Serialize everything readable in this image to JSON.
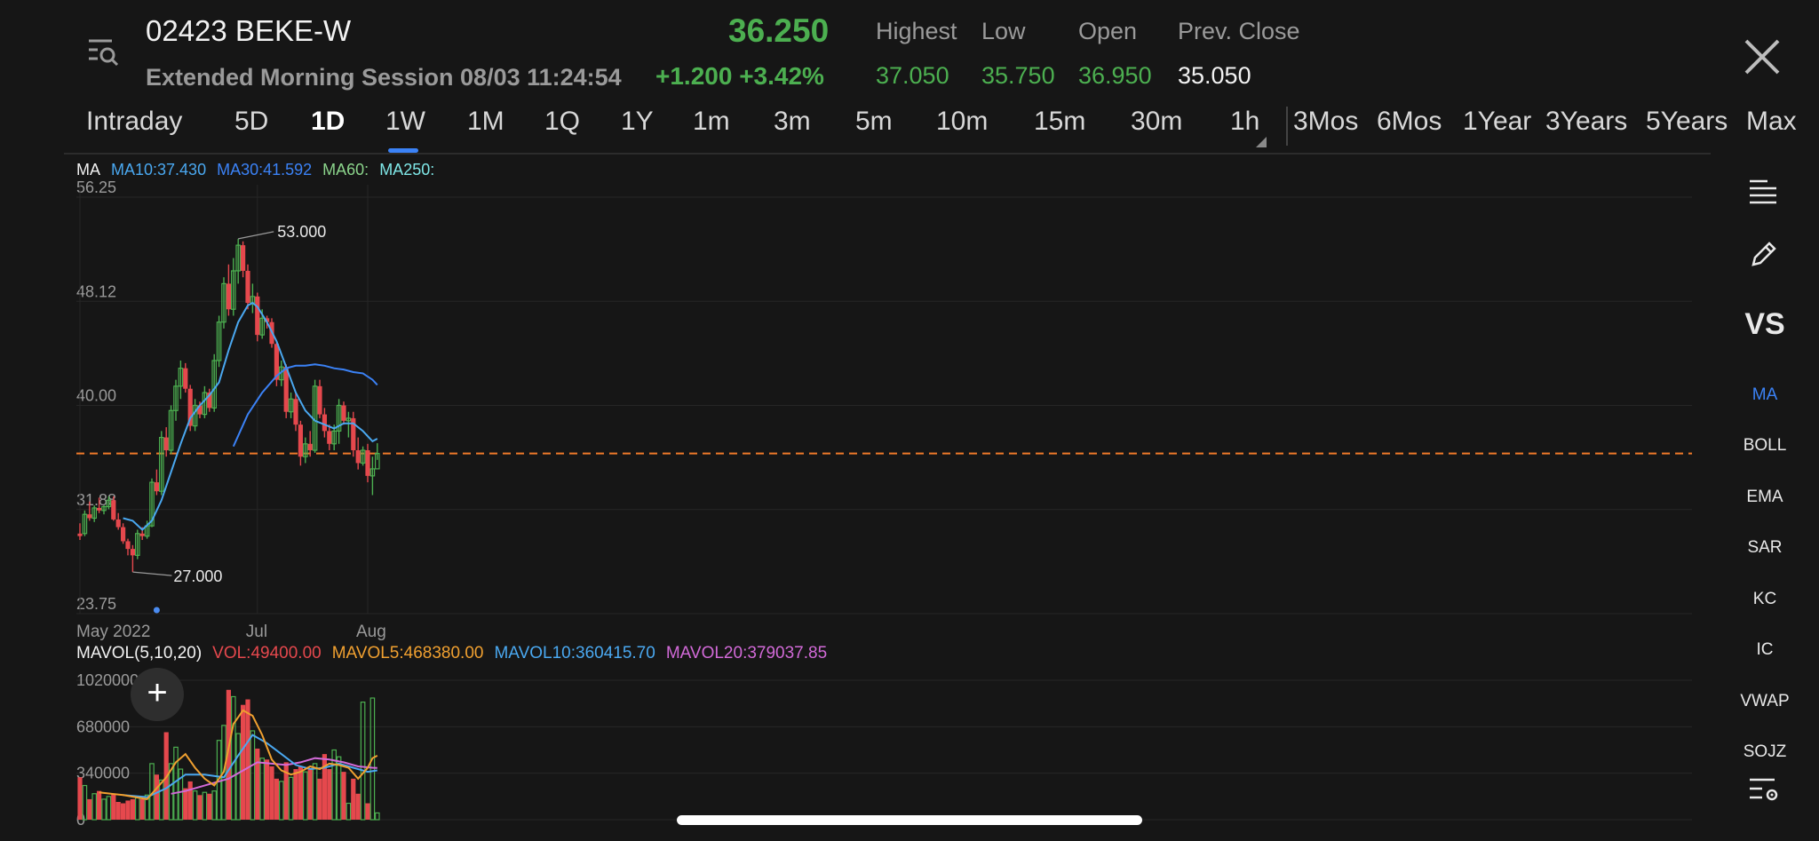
{
  "header": {
    "ticker": "02423 BEKE-W",
    "session": "Extended Morning Session 08/03 11:24:54",
    "price": "36.250",
    "change": "+1.200",
    "change_pct": "+3.42%",
    "stats": [
      {
        "label": "Highest",
        "value": "37.050"
      },
      {
        "label": "Low",
        "value": "35.750"
      },
      {
        "label": "Open",
        "value": "36.950"
      },
      {
        "label": "Prev. Close",
        "value": "35.050"
      }
    ],
    "menu_icon": "list-search-icon",
    "close_icon": "close-icon"
  },
  "tabs": [
    "Intraday",
    "5D",
    "1D",
    "1W",
    "1M",
    "1Q",
    "1Y",
    "1m",
    "3m",
    "5m",
    "10m",
    "15m",
    "30m",
    "1h",
    "3Mos",
    "6Mos",
    "1Year",
    "3Years",
    "5Years",
    "Max"
  ],
  "active_tab": "1D",
  "ma_legend": {
    "title": "MA",
    "ma10": "MA10:37.430",
    "ma30": "MA30:41.592",
    "ma60": "MA60:",
    "ma250": "MA250:"
  },
  "mavol_legend": {
    "title": "MAVOL(5,10,20)",
    "vol": "VOL:49400.00",
    "mavol5": "MAVOL5:468380.00",
    "mavol10": "MAVOL10:360415.70",
    "mavol20": "MAVOL20:379037.85"
  },
  "right_panel": {
    "icons": [
      "indicator-list-icon",
      "pencil-icon",
      "indicator-settings-icon"
    ],
    "vs": "VS",
    "indicators": [
      "MA",
      "BOLL",
      "EMA",
      "SAR",
      "KC",
      "IC",
      "VWAP",
      "SOJZ"
    ],
    "active_indicator": "MA"
  },
  "plus_label": "+",
  "colors": {
    "up": "#4caf50",
    "down": "#e5484d",
    "ma10": "#4aa8f0",
    "ma30": "#3b82f6",
    "accent": "#3b82f6",
    "ref_line": "#f07a2a"
  },
  "chart_data": [
    {
      "type": "candlestick",
      "title": "",
      "y_ticks": [
        "56.25",
        "48.12",
        "40.00",
        "31.88",
        "23.75"
      ],
      "ylim": [
        23.75,
        56.25
      ],
      "x_ticks": [
        "May 2022",
        "Jul",
        "Aug"
      ],
      "annotations": {
        "high": "53.000",
        "low": "27.000"
      },
      "reference_price": 36.25,
      "ohlc": [
        [
          30.0,
          30.8,
          29.5,
          29.8
        ],
        [
          30.0,
          31.8,
          29.8,
          31.5
        ],
        [
          31.5,
          32.5,
          31.0,
          31.2
        ],
        [
          31.2,
          32.2,
          30.9,
          32.0
        ],
        [
          32.0,
          32.8,
          31.6,
          31.8
        ],
        [
          31.8,
          32.2,
          31.5,
          32.1
        ],
        [
          32.1,
          32.9,
          31.9,
          32.6
        ],
        [
          32.6,
          32.9,
          31.0,
          31.1
        ],
        [
          31.1,
          31.6,
          30.3,
          30.5
        ],
        [
          30.5,
          30.8,
          29.2,
          29.4
        ],
        [
          29.4,
          29.6,
          28.3,
          28.8
        ],
        [
          28.8,
          29.1,
          27.0,
          28.3
        ],
        [
          28.3,
          30.3,
          28.0,
          30.0
        ],
        [
          30.0,
          30.5,
          29.5,
          29.8
        ],
        [
          29.8,
          31.0,
          29.6,
          30.6
        ],
        [
          30.6,
          34.3,
          30.5,
          34.0
        ],
        [
          34.0,
          35.0,
          33.0,
          33.3
        ],
        [
          33.3,
          38.0,
          33.0,
          37.5
        ],
        [
          37.5,
          38.3,
          36.0,
          36.5
        ],
        [
          36.5,
          40.0,
          36.2,
          39.6
        ],
        [
          39.6,
          42.0,
          38.8,
          41.5
        ],
        [
          41.5,
          43.5,
          40.5,
          42.9
        ],
        [
          42.9,
          43.3,
          41.0,
          41.3
        ],
        [
          41.3,
          41.6,
          38.0,
          38.4
        ],
        [
          38.4,
          40.5,
          38.0,
          40.0
        ],
        [
          40.0,
          40.3,
          39.0,
          39.3
        ],
        [
          39.3,
          41.5,
          39.0,
          41.0
        ],
        [
          41.0,
          41.3,
          39.5,
          39.8
        ],
        [
          39.8,
          44.0,
          39.5,
          43.5
        ],
        [
          43.5,
          47.0,
          43.0,
          46.5
        ],
        [
          46.5,
          50.0,
          46.0,
          49.5
        ],
        [
          49.5,
          51.0,
          47.0,
          47.5
        ],
        [
          47.5,
          51.5,
          47.0,
          50.5
        ],
        [
          50.5,
          53.0,
          49.5,
          52.5
        ],
        [
          52.5,
          52.8,
          50.0,
          50.5
        ],
        [
          50.5,
          51.0,
          47.5,
          48.0
        ],
        [
          48.0,
          49.5,
          47.2,
          48.5
        ],
        [
          48.5,
          48.8,
          45.0,
          45.5
        ],
        [
          45.5,
          47.5,
          45.2,
          46.8
        ],
        [
          46.8,
          47.0,
          46.0,
          46.5
        ],
        [
          46.5,
          46.8,
          44.5,
          44.8
        ],
        [
          44.8,
          45.0,
          41.5,
          42.0
        ],
        [
          42.0,
          43.5,
          41.5,
          43.0
        ],
        [
          43.0,
          43.2,
          39.0,
          39.5
        ],
        [
          39.5,
          41.0,
          39.0,
          40.5
        ],
        [
          40.5,
          41.0,
          38.0,
          38.5
        ],
        [
          38.5,
          38.8,
          35.3,
          36.0
        ],
        [
          36.0,
          37.5,
          35.5,
          37.0
        ],
        [
          37.0,
          38.0,
          36.0,
          36.5
        ],
        [
          36.5,
          42.0,
          36.3,
          41.5
        ],
        [
          41.5,
          42.0,
          39.0,
          39.3
        ],
        [
          39.3,
          39.8,
          37.5,
          38.0
        ],
        [
          38.0,
          38.5,
          36.5,
          37.0
        ],
        [
          37.0,
          38.5,
          36.5,
          38.0
        ],
        [
          38.0,
          40.5,
          37.0,
          40.0
        ],
        [
          40.0,
          40.3,
          38.5,
          38.8
        ],
        [
          38.8,
          39.5,
          37.5,
          39.0
        ],
        [
          39.0,
          39.5,
          36.0,
          36.5
        ],
        [
          36.5,
          37.5,
          35.0,
          35.5
        ],
        [
          35.5,
          36.8,
          35.3,
          36.5
        ],
        [
          36.5,
          37.0,
          34.0,
          34.5
        ],
        [
          34.5,
          36.0,
          33.0,
          35.05
        ],
        [
          35.05,
          37.05,
          35.75,
          36.25
        ]
      ],
      "ma10": [
        [
          9,
          31.2
        ],
        [
          11,
          31.0
        ],
        [
          13,
          30.3
        ],
        [
          15,
          31.0
        ],
        [
          17,
          32.6
        ],
        [
          19,
          34.8
        ],
        [
          21,
          37.0
        ],
        [
          23,
          39.0
        ],
        [
          25,
          40.0
        ],
        [
          27,
          40.8
        ],
        [
          29,
          41.8
        ],
        [
          31,
          44.3
        ],
        [
          33,
          46.5
        ],
        [
          35,
          47.8
        ],
        [
          36,
          48.0
        ],
        [
          37,
          47.7
        ],
        [
          39,
          46.5
        ],
        [
          41,
          45.0
        ],
        [
          43,
          43.0
        ],
        [
          45,
          41.0
        ],
        [
          47,
          39.6
        ],
        [
          49,
          38.8
        ],
        [
          51,
          38.5
        ],
        [
          53,
          38.2
        ],
        [
          55,
          38.6
        ],
        [
          57,
          38.6
        ],
        [
          59,
          38.0
        ],
        [
          61,
          37.2
        ],
        [
          62,
          37.4
        ]
      ],
      "ma30": [
        [
          32,
          36.8
        ],
        [
          35,
          39.3
        ],
        [
          38,
          41.0
        ],
        [
          41,
          42.3
        ],
        [
          43,
          42.9
        ],
        [
          45,
          43.1
        ],
        [
          47,
          43.1
        ],
        [
          49,
          43.2
        ],
        [
          51,
          43.1
        ],
        [
          53,
          42.9
        ],
        [
          55,
          42.8
        ],
        [
          57,
          42.6
        ],
        [
          59,
          42.5
        ],
        [
          61,
          42.0
        ],
        [
          62,
          41.6
        ]
      ]
    },
    {
      "type": "bar",
      "title": "",
      "y_ticks": [
        "1020000",
        "680000",
        "340000",
        "0"
      ],
      "ylim": [
        0,
        1020000
      ],
      "values": [
        310000,
        250000,
        150000,
        190000,
        210000,
        150000,
        170000,
        190000,
        130000,
        120000,
        140000,
        150000,
        160000,
        150000,
        180000,
        410000,
        330000,
        290000,
        640000,
        410000,
        530000,
        370000,
        230000,
        280000,
        210000,
        180000,
        200000,
        190000,
        210000,
        580000,
        690000,
        950000,
        900000,
        630000,
        840000,
        880000,
        650000,
        520000,
        450000,
        440000,
        390000,
        300000,
        280000,
        420000,
        310000,
        370000,
        390000,
        350000,
        370000,
        410000,
        300000,
        480000,
        370000,
        510000,
        460000,
        350000,
        120000,
        300000,
        190000,
        860000,
        120000,
        890000,
        49400
      ],
      "mavol5": [
        [
          4,
          200000
        ],
        [
          9,
          180000
        ],
        [
          14,
          150000
        ],
        [
          16,
          230000
        ],
        [
          18,
          310000
        ],
        [
          20,
          420000
        ],
        [
          22,
          480000
        ],
        [
          24,
          380000
        ],
        [
          26,
          300000
        ],
        [
          28,
          250000
        ],
        [
          30,
          350000
        ],
        [
          32,
          700000
        ],
        [
          34,
          800000
        ],
        [
          36,
          760000
        ],
        [
          38,
          620000
        ],
        [
          40,
          440000
        ],
        [
          42,
          360000
        ],
        [
          44,
          330000
        ],
        [
          46,
          350000
        ],
        [
          48,
          390000
        ],
        [
          50,
          370000
        ],
        [
          52,
          410000
        ],
        [
          54,
          400000
        ],
        [
          56,
          380000
        ],
        [
          58,
          300000
        ],
        [
          60,
          380000
        ],
        [
          61,
          450000
        ],
        [
          62,
          468380
        ]
      ],
      "mavol10": [
        [
          9,
          180000
        ],
        [
          14,
          165000
        ],
        [
          18,
          230000
        ],
        [
          22,
          330000
        ],
        [
          26,
          330000
        ],
        [
          30,
          310000
        ],
        [
          33,
          470000
        ],
        [
          36,
          620000
        ],
        [
          39,
          560000
        ],
        [
          42,
          480000
        ],
        [
          45,
          400000
        ],
        [
          48,
          370000
        ],
        [
          51,
          380000
        ],
        [
          54,
          410000
        ],
        [
          57,
          380000
        ],
        [
          60,
          350000
        ],
        [
          62,
          360416
        ]
      ],
      "mavol20": [
        [
          19,
          190000
        ],
        [
          22,
          210000
        ],
        [
          25,
          240000
        ],
        [
          28,
          270000
        ],
        [
          31,
          300000
        ],
        [
          34,
          360000
        ],
        [
          37,
          420000
        ],
        [
          40,
          410000
        ],
        [
          43,
          400000
        ],
        [
          46,
          420000
        ],
        [
          49,
          450000
        ],
        [
          52,
          440000
        ],
        [
          55,
          420000
        ],
        [
          58,
          390000
        ],
        [
          61,
          380000
        ],
        [
          62,
          379038
        ]
      ]
    }
  ]
}
